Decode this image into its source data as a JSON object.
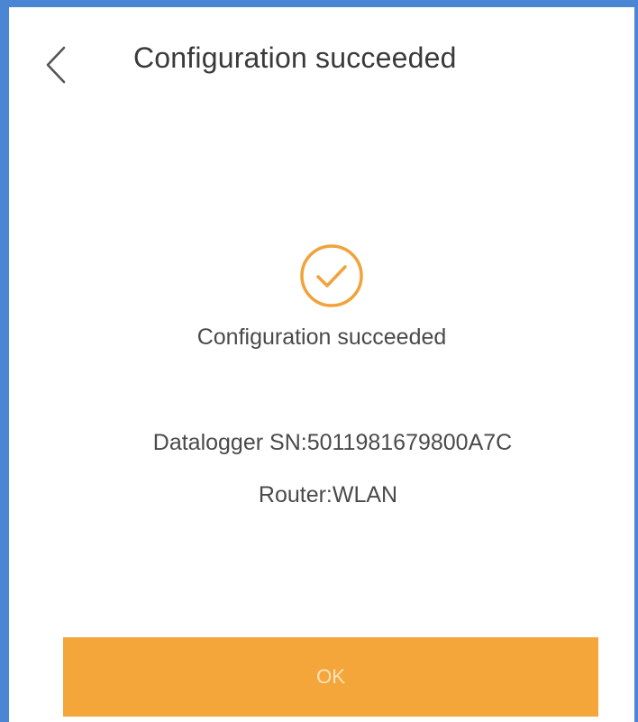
{
  "header": {
    "title": "Configuration succeeded",
    "back_icon": "chevron-left-icon"
  },
  "result": {
    "icon": "check-circle-icon",
    "status": "Configuration succeeded",
    "datalogger_sn": "Datalogger SN:5011981679800A7C",
    "router": "Router:WLAN"
  },
  "actions": {
    "ok_label": "OK"
  },
  "colors": {
    "accent": "#f4a63b",
    "frame": "#4a86d4",
    "text": "#4a4a4a"
  }
}
